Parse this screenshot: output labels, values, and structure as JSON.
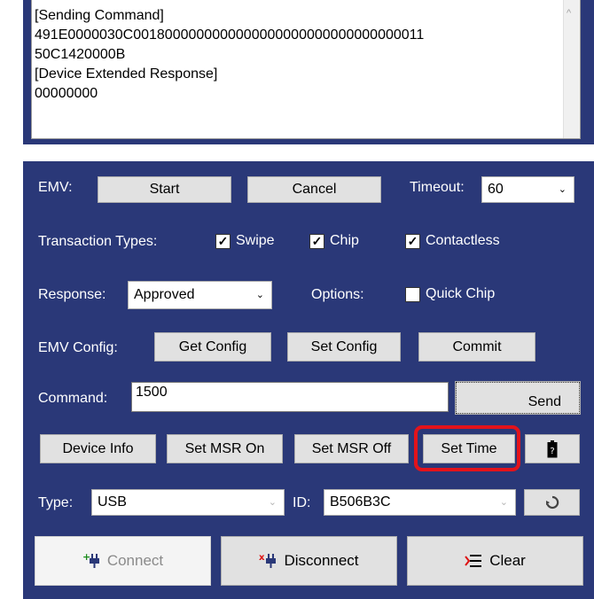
{
  "log": {
    "lines": [
      "[Sending Command]",
      "491E0000030C0018000000000000000000000000000000011",
      "50C1420000B",
      "[Device Extended Response]",
      "00000000"
    ],
    "scroll_up_glyph": "^"
  },
  "emv": {
    "label": "EMV:",
    "start_label": "Start",
    "cancel_label": "Cancel",
    "timeout_label": "Timeout:",
    "timeout_value": "60"
  },
  "transaction_types": {
    "label": "Transaction Types:",
    "items": [
      {
        "label": "Swipe",
        "checked": true
      },
      {
        "label": "Chip",
        "checked": true
      },
      {
        "label": "Contactless",
        "checked": true
      }
    ]
  },
  "response": {
    "label": "Response:",
    "value": "Approved",
    "options_label": "Options:",
    "quick_chip_label": "Quick Chip",
    "quick_chip_checked": false
  },
  "emv_config": {
    "label": "EMV Config:",
    "get_label": "Get Config",
    "set_label": "Set Config",
    "commit_label": "Commit"
  },
  "command": {
    "label": "Command:",
    "value": "1500",
    "send_label": "Send"
  },
  "device_buttons": {
    "device_info": "Device Info",
    "msr_on": "Set MSR On",
    "msr_off": "Set MSR Off",
    "set_time": "Set Time",
    "battery_icon": "battery-icon"
  },
  "connection": {
    "type_label": "Type:",
    "type_value": "USB",
    "id_label": "ID:",
    "id_value": "B506B3C",
    "refresh_icon": "refresh-icon"
  },
  "actions": {
    "connect_label": "Connect",
    "disconnect_label": "Disconnect",
    "clear_label": "Clear"
  },
  "colors": {
    "panel_bg": "#2a3878",
    "highlight": "#e3131b"
  }
}
